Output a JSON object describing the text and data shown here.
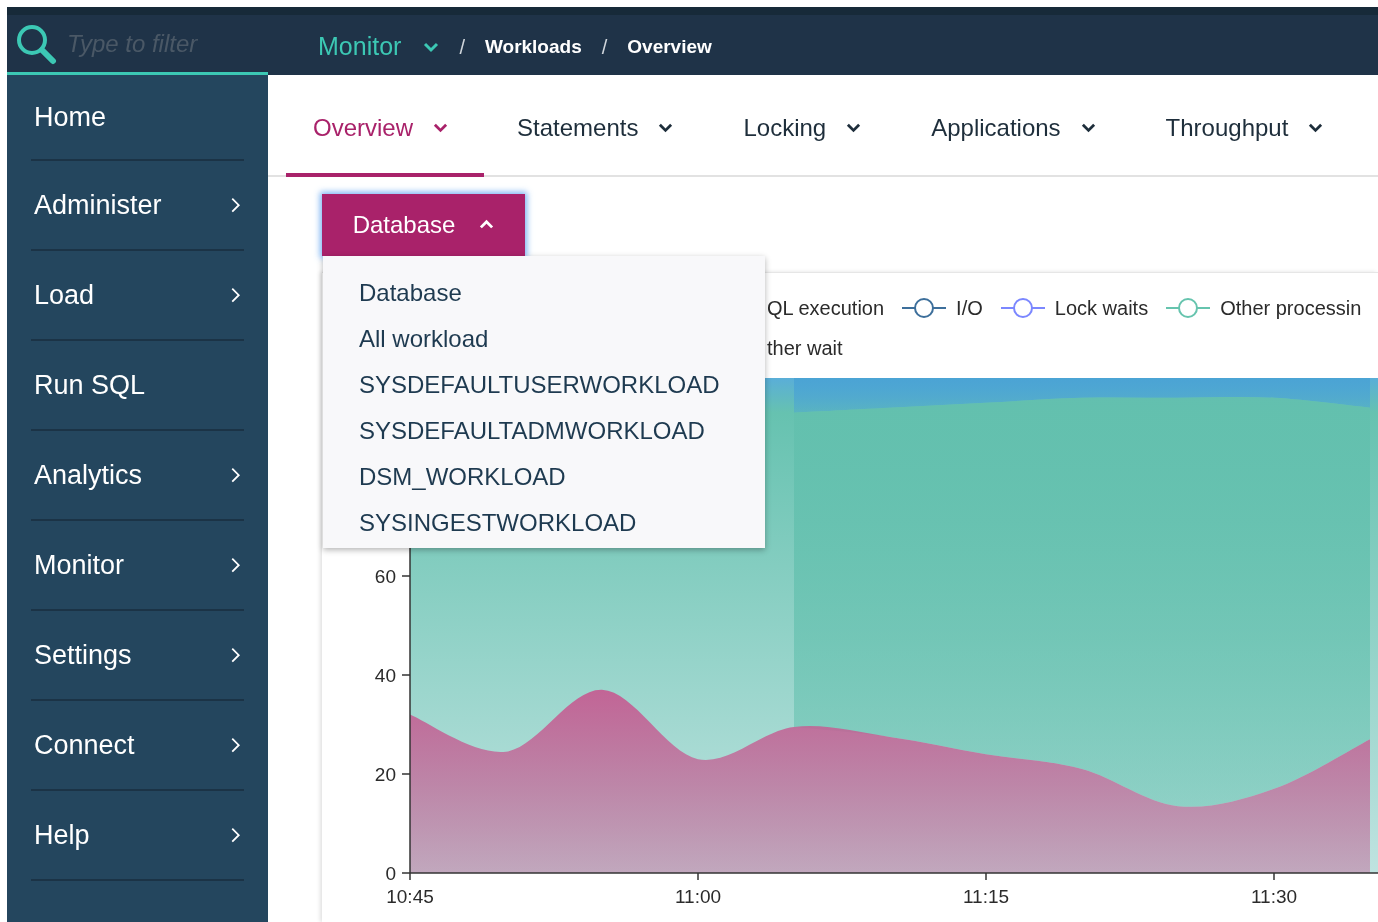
{
  "search": {
    "placeholder": "Type to filter"
  },
  "breadcrumb": [
    {
      "kind": "menu",
      "label": "Monitor"
    },
    {
      "kind": "separator",
      "label": "/"
    },
    {
      "kind": "page",
      "label": "Workloads"
    },
    {
      "kind": "separator",
      "label": "/"
    },
    {
      "kind": "page",
      "label": "Overview"
    }
  ],
  "sidebar": {
    "items": [
      {
        "label": "Home",
        "has_submenu": false
      },
      {
        "label": "Administer",
        "has_submenu": true
      },
      {
        "label": "Load",
        "has_submenu": true
      },
      {
        "label": "Run SQL",
        "has_submenu": false
      },
      {
        "label": "Analytics",
        "has_submenu": true
      },
      {
        "label": "Monitor",
        "has_submenu": true
      },
      {
        "label": "Settings",
        "has_submenu": true
      },
      {
        "label": "Connect",
        "has_submenu": true
      },
      {
        "label": "Help",
        "has_submenu": true
      }
    ]
  },
  "tabs": [
    {
      "label": "Overview",
      "selected": true
    },
    {
      "label": "Statements",
      "selected": false
    },
    {
      "label": "Locking",
      "selected": false
    },
    {
      "label": "Applications",
      "selected": false
    },
    {
      "label": "Throughput",
      "selected": false
    }
  ],
  "scope_dropdown": {
    "label": "Database",
    "expanded": true,
    "options": [
      "Database",
      "All workload",
      "SYSDEFAULTUSERWORKLOAD",
      "SYSDEFAULTADMWORKLOAD",
      "DSM_WORKLOAD",
      "SYSINGESTWORKLOAD"
    ]
  },
  "chart": {
    "legend": [
      [
        {
          "kind": "plain",
          "label": "QL execution"
        },
        {
          "kind": "marker",
          "label": "I/O",
          "color": "#3d6f9b"
        },
        {
          "kind": "marker",
          "label": "Lock waits",
          "color": "#7b87ff"
        },
        {
          "kind": "marker",
          "label": "Other processin",
          "color": "#66c4ae"
        }
      ],
      [
        {
          "kind": "plain",
          "label": "ther wait"
        }
      ]
    ],
    "chart_data": {
      "type": "area",
      "stacked": true,
      "categories": [
        "10:45",
        null,
        null,
        "11:00",
        null,
        null,
        "11:15",
        null,
        null,
        "11:30",
        null
      ],
      "ylim": [
        0,
        100
      ],
      "yticks": [
        0,
        20,
        40,
        60
      ],
      "series": [
        {
          "color": "#c45f93",
          "values": [
            32,
            24.5,
            37,
            23,
            29.5,
            27.5,
            24,
            21,
            13.5,
            17,
            27
          ]
        },
        {
          "color": "#63c0ae",
          "values": [
            null,
            null,
            null,
            null,
            63.5,
            66.5,
            71,
            75,
            82.5,
            79,
            67
          ]
        },
        {
          "color": "#4aa3d4",
          "values": [
            null,
            null,
            null,
            null,
            7,
            6,
            5,
            4,
            4,
            4,
            6
          ]
        }
      ]
    }
  }
}
